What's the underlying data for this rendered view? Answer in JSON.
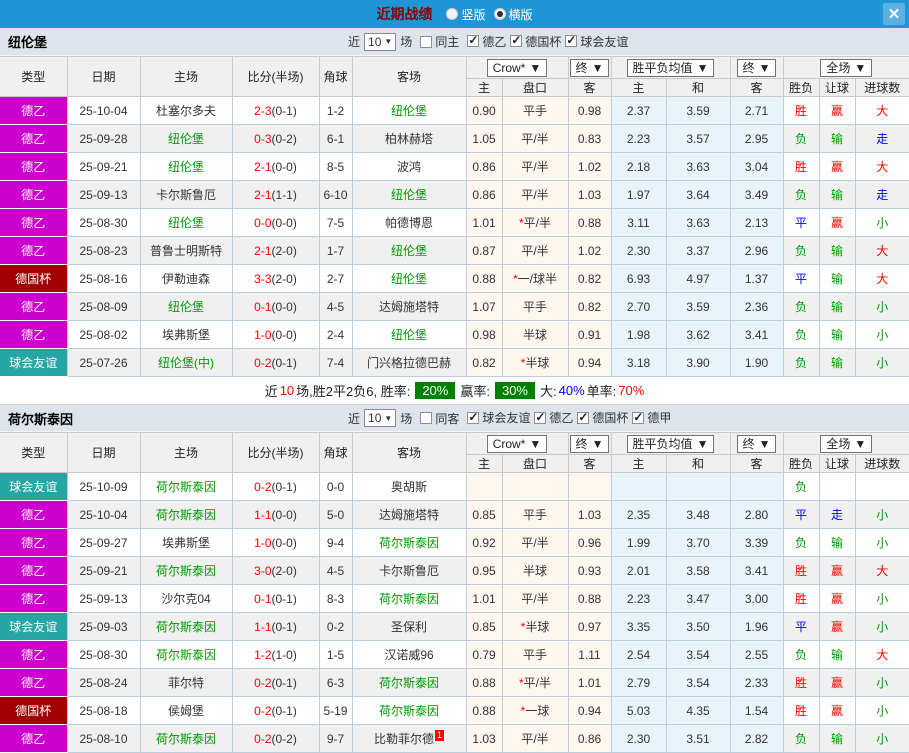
{
  "topbar": {
    "title": "近期战绩",
    "radio_vertical": "竖版",
    "radio_horizontal": "横版"
  },
  "icons": {
    "arrow_down": "▼",
    "check": "✓",
    "close": "✕"
  },
  "colors": {
    "accent-blue": "#2095d5",
    "title-red": "#8b0000",
    "badge-de2": "#cc00cc",
    "badge-cup": "#a00000",
    "badge-fr": "#26a5a5",
    "badge-rate": "#008000",
    "c-red": "#ff0000",
    "c-green": "#009900",
    "c-blue": "#0000ff",
    "grid": "#b9cede",
    "row-alt": "#f0f0f0",
    "tint-crow": "#fdf7ef",
    "tint-wdl": "#e9f3fa"
  },
  "filter": {
    "near": "近",
    "count": "10",
    "games": "场"
  },
  "header": {
    "type": "类型",
    "date": "日期",
    "home": "主场",
    "score": "比分(半场)",
    "corner": "角球",
    "away": "客场",
    "dd_crow": "Crow*",
    "dd_final": "终",
    "dd_wdl": "胜平负均值",
    "dd_final2": "终",
    "dd_full": "全场",
    "sub_home": "主",
    "sub_handicap": "盘口",
    "sub_away": "客",
    "sub_w": "主",
    "sub_d": "和",
    "sub_l": "客",
    "sub_wl": "胜负",
    "sub_let": "让球",
    "sub_goals": "进球数"
  },
  "sections": [
    {
      "team": "纽伦堡",
      "same": "同主",
      "same_checked": false,
      "leagues": [
        "德乙",
        "德国杯",
        "球会友谊"
      ],
      "rows": [
        {
          "t": "德乙",
          "tc": "bg-de2",
          "d": "25-10-04",
          "h": "杜塞尔多夫",
          "hc": "",
          "ft": "2-3",
          "ht": "(0-1)",
          "cn": "1-2",
          "a": "纽伦堡",
          "ac": "f-g",
          "ab": "",
          "o1": "0.90",
          "st": "",
          "hd": "平手",
          "o2": "0.98",
          "w": "2.37",
          "dr": "3.59",
          "l": "2.71",
          "r1": "胜",
          "c1": "f-r",
          "r2": "赢",
          "c2": "f-r",
          "r3": "大",
          "c3": "f-r"
        },
        {
          "t": "德乙",
          "tc": "bg-de2",
          "d": "25-09-28",
          "h": "纽伦堡",
          "hc": "f-g",
          "ft": "0-3",
          "ht": "(0-2)",
          "cn": "6-1",
          "a": "柏林赫塔",
          "ac": "",
          "ab": "",
          "o1": "1.05",
          "st": "",
          "hd": "平/半",
          "o2": "0.83",
          "w": "2.23",
          "dr": "3.57",
          "l": "2.95",
          "r1": "负",
          "c1": "f-g",
          "r2": "输",
          "c2": "f-g",
          "r3": "走",
          "c3": "f-b"
        },
        {
          "t": "德乙",
          "tc": "bg-de2",
          "d": "25-09-21",
          "h": "纽伦堡",
          "hc": "f-g",
          "ft": "2-1",
          "ht": "(0-0)",
          "cn": "8-5",
          "a": "波鸿",
          "ac": "",
          "ab": "",
          "o1": "0.86",
          "st": "",
          "hd": "平/半",
          "o2": "1.02",
          "w": "2.18",
          "dr": "3.63",
          "l": "3.04",
          "r1": "胜",
          "c1": "f-r",
          "r2": "赢",
          "c2": "f-r",
          "r3": "大",
          "c3": "f-r"
        },
        {
          "t": "德乙",
          "tc": "bg-de2",
          "d": "25-09-13",
          "h": "卡尔斯鲁厄",
          "hc": "",
          "ft": "2-1",
          "ht": "(1-1)",
          "cn": "6-10",
          "a": "纽伦堡",
          "ac": "f-g",
          "ab": "",
          "o1": "0.86",
          "st": "",
          "hd": "平/半",
          "o2": "1.03",
          "w": "1.97",
          "dr": "3.64",
          "l": "3.49",
          "r1": "负",
          "c1": "f-g",
          "r2": "输",
          "c2": "f-g",
          "r3": "走",
          "c3": "f-b"
        },
        {
          "t": "德乙",
          "tc": "bg-de2",
          "d": "25-08-30",
          "h": "纽伦堡",
          "hc": "f-g",
          "ft": "0-0",
          "ht": "(0-0)",
          "cn": "7-5",
          "a": "帕德博恩",
          "ac": "",
          "ab": "",
          "o1": "1.01",
          "st": "*",
          "hd": "平/半",
          "o2": "0.88",
          "w": "3.11",
          "dr": "3.63",
          "l": "2.13",
          "r1": "平",
          "c1": "f-b",
          "r2": "赢",
          "c2": "f-r",
          "r3": "小",
          "c3": "f-g"
        },
        {
          "t": "德乙",
          "tc": "bg-de2",
          "d": "25-08-23",
          "h": "普鲁士明斯特",
          "hc": "",
          "ft": "2-1",
          "ht": "(2-0)",
          "cn": "1-7",
          "a": "纽伦堡",
          "ac": "f-g",
          "ab": "",
          "o1": "0.87",
          "st": "",
          "hd": "平/半",
          "o2": "1.02",
          "w": "2.30",
          "dr": "3.37",
          "l": "2.96",
          "r1": "负",
          "c1": "f-g",
          "r2": "输",
          "c2": "f-g",
          "r3": "大",
          "c3": "f-r"
        },
        {
          "t": "德国杯",
          "tc": "bg-cup",
          "d": "25-08-16",
          "h": "伊勒迪森",
          "hc": "",
          "ft": "3-3",
          "ht": "(2-0)",
          "cn": "2-7",
          "a": "纽伦堡",
          "ac": "f-g",
          "ab": "",
          "o1": "0.88",
          "st": "*",
          "hd": "一/球半",
          "o2": "0.82",
          "w": "6.93",
          "dr": "4.97",
          "l": "1.37",
          "r1": "平",
          "c1": "f-b",
          "r2": "输",
          "c2": "f-g",
          "r3": "大",
          "c3": "f-r"
        },
        {
          "t": "德乙",
          "tc": "bg-de2",
          "d": "25-08-09",
          "h": "纽伦堡",
          "hc": "f-g",
          "ft": "0-1",
          "ht": "(0-0)",
          "cn": "4-5",
          "a": "达姆施塔特",
          "ac": "",
          "ab": "",
          "o1": "1.07",
          "st": "",
          "hd": "平手",
          "o2": "0.82",
          "w": "2.70",
          "dr": "3.59",
          "l": "2.36",
          "r1": "负",
          "c1": "f-g",
          "r2": "输",
          "c2": "f-g",
          "r3": "小",
          "c3": "f-g"
        },
        {
          "t": "德乙",
          "tc": "bg-de2",
          "d": "25-08-02",
          "h": "埃弗斯堡",
          "hc": "",
          "ft": "1-0",
          "ht": "(0-0)",
          "cn": "2-4",
          "a": "纽伦堡",
          "ac": "f-g",
          "ab": "",
          "o1": "0.98",
          "st": "",
          "hd": "半球",
          "o2": "0.91",
          "w": "1.98",
          "dr": "3.62",
          "l": "3.41",
          "r1": "负",
          "c1": "f-g",
          "r2": "输",
          "c2": "f-g",
          "r3": "小",
          "c3": "f-g"
        },
        {
          "t": "球会友谊",
          "tc": "bg-fr",
          "d": "25-07-26",
          "h": "纽伦堡(中)",
          "hc": "f-g",
          "ft": "0-2",
          "ht": "(0-1)",
          "cn": "7-4",
          "a": "门兴格拉德巴赫",
          "ac": "",
          "ab": "",
          "o1": "0.82",
          "st": "*",
          "hd": "半球",
          "o2": "0.94",
          "w": "3.18",
          "dr": "3.90",
          "l": "1.90",
          "r1": "负",
          "c1": "f-g",
          "r2": "输",
          "c2": "f-g",
          "r3": "小",
          "c3": "f-g"
        }
      ],
      "summary": {
        "p1": "近",
        "p2": "10",
        "p3": "场,胜2平2负6, 胜率:",
        "b1": "20%",
        "p4": "赢率:",
        "b2": "30%",
        "p5": "大:",
        "v1": "40%",
        "p6": "单率:",
        "v2": "70%"
      }
    },
    {
      "team": "荷尔斯泰因",
      "same": "同客",
      "same_checked": false,
      "leagues": [
        "球会友谊",
        "德乙",
        "德国杯",
        "德甲"
      ],
      "rows": [
        {
          "t": "球会友谊",
          "tc": "bg-fr",
          "d": "25-10-09",
          "h": "荷尔斯泰因",
          "hc": "f-g",
          "ft": "0-2",
          "ht": "(0-1)",
          "cn": "0-0",
          "a": "奥胡斯",
          "ac": "",
          "ab": "",
          "o1": "",
          "st": "",
          "hd": "",
          "o2": "",
          "w": "",
          "dr": "",
          "l": "",
          "r1": "负",
          "c1": "f-g",
          "r2": "",
          "c2": "",
          "r3": "",
          "c3": ""
        },
        {
          "t": "德乙",
          "tc": "bg-de2",
          "d": "25-10-04",
          "h": "荷尔斯泰因",
          "hc": "f-g",
          "ft": "1-1",
          "ht": "(0-0)",
          "cn": "5-0",
          "a": "达姆施塔特",
          "ac": "",
          "ab": "",
          "o1": "0.85",
          "st": "",
          "hd": "平手",
          "o2": "1.03",
          "w": "2.35",
          "dr": "3.48",
          "l": "2.80",
          "r1": "平",
          "c1": "f-b",
          "r2": "走",
          "c2": "f-b",
          "r3": "小",
          "c3": "f-g"
        },
        {
          "t": "德乙",
          "tc": "bg-de2",
          "d": "25-09-27",
          "h": "埃弗斯堡",
          "hc": "",
          "ft": "1-0",
          "ht": "(0-0)",
          "cn": "9-4",
          "a": "荷尔斯泰因",
          "ac": "f-g",
          "ab": "",
          "o1": "0.92",
          "st": "",
          "hd": "平/半",
          "o2": "0.96",
          "w": "1.99",
          "dr": "3.70",
          "l": "3.39",
          "r1": "负",
          "c1": "f-g",
          "r2": "输",
          "c2": "f-g",
          "r3": "小",
          "c3": "f-g"
        },
        {
          "t": "德乙",
          "tc": "bg-de2",
          "d": "25-09-21",
          "h": "荷尔斯泰因",
          "hc": "f-g",
          "ft": "3-0",
          "ht": "(2-0)",
          "cn": "4-5",
          "a": "卡尔斯鲁厄",
          "ac": "",
          "ab": "",
          "o1": "0.95",
          "st": "",
          "hd": "半球",
          "o2": "0.93",
          "w": "2.01",
          "dr": "3.58",
          "l": "3.41",
          "r1": "胜",
          "c1": "f-r",
          "r2": "赢",
          "c2": "f-r",
          "r3": "大",
          "c3": "f-r"
        },
        {
          "t": "德乙",
          "tc": "bg-de2",
          "d": "25-09-13",
          "h": "沙尔克04",
          "hc": "",
          "ft": "0-1",
          "ht": "(0-1)",
          "cn": "8-3",
          "a": "荷尔斯泰因",
          "ac": "f-g",
          "ab": "",
          "o1": "1.01",
          "st": "",
          "hd": "平/半",
          "o2": "0.88",
          "w": "2.23",
          "dr": "3.47",
          "l": "3.00",
          "r1": "胜",
          "c1": "f-r",
          "r2": "赢",
          "c2": "f-r",
          "r3": "小",
          "c3": "f-g"
        },
        {
          "t": "球会友谊",
          "tc": "bg-fr",
          "d": "25-09-03",
          "h": "荷尔斯泰因",
          "hc": "f-g",
          "ft": "1-1",
          "ht": "(0-1)",
          "cn": "0-2",
          "a": "圣保利",
          "ac": "",
          "ab": "",
          "o1": "0.85",
          "st": "*",
          "hd": "半球",
          "o2": "0.97",
          "w": "3.35",
          "dr": "3.50",
          "l": "1.96",
          "r1": "平",
          "c1": "f-b",
          "r2": "赢",
          "c2": "f-r",
          "r3": "小",
          "c3": "f-g"
        },
        {
          "t": "德乙",
          "tc": "bg-de2",
          "d": "25-08-30",
          "h": "荷尔斯泰因",
          "hc": "f-g",
          "ft": "1-2",
          "ht": "(1-0)",
          "cn": "1-5",
          "a": "汉诺威96",
          "ac": "",
          "ab": "",
          "o1": "0.79",
          "st": "",
          "hd": "平手",
          "o2": "1.11",
          "w": "2.54",
          "dr": "3.54",
          "l": "2.55",
          "r1": "负",
          "c1": "f-g",
          "r2": "输",
          "c2": "f-g",
          "r3": "大",
          "c3": "f-r"
        },
        {
          "t": "德乙",
          "tc": "bg-de2",
          "d": "25-08-24",
          "h": "菲尔特",
          "hc": "",
          "ft": "0-2",
          "ht": "(0-1)",
          "cn": "6-3",
          "a": "荷尔斯泰因",
          "ac": "f-g",
          "ab": "",
          "o1": "0.88",
          "st": "*",
          "hd": "平/半",
          "o2": "1.01",
          "w": "2.79",
          "dr": "3.54",
          "l": "2.33",
          "r1": "胜",
          "c1": "f-r",
          "r2": "赢",
          "c2": "f-r",
          "r3": "小",
          "c3": "f-g"
        },
        {
          "t": "德国杯",
          "tc": "bg-cup",
          "d": "25-08-18",
          "h": "侯姆堡",
          "hc": "",
          "ft": "0-2",
          "ht": "(0-1)",
          "cn": "5-19",
          "a": "荷尔斯泰因",
          "ac": "f-g",
          "ab": "",
          "o1": "0.88",
          "st": "*",
          "hd": "一球",
          "o2": "0.94",
          "w": "5.03",
          "dr": "4.35",
          "l": "1.54",
          "r1": "胜",
          "c1": "f-r",
          "r2": "赢",
          "c2": "f-r",
          "r3": "小",
          "c3": "f-g"
        },
        {
          "t": "德乙",
          "tc": "bg-de2",
          "d": "25-08-10",
          "h": "荷尔斯泰因",
          "hc": "f-g",
          "ft": "0-2",
          "ht": "(0-2)",
          "cn": "9-7",
          "a": "比勒菲尔德",
          "ac": "",
          "ab": "1",
          "o1": "1.03",
          "st": "",
          "hd": "平/半",
          "o2": "0.86",
          "w": "2.30",
          "dr": "3.51",
          "l": "2.82",
          "r1": "负",
          "c1": "f-g",
          "r2": "输",
          "c2": "f-g",
          "r3": "小",
          "c3": "f-g"
        }
      ]
    }
  ]
}
